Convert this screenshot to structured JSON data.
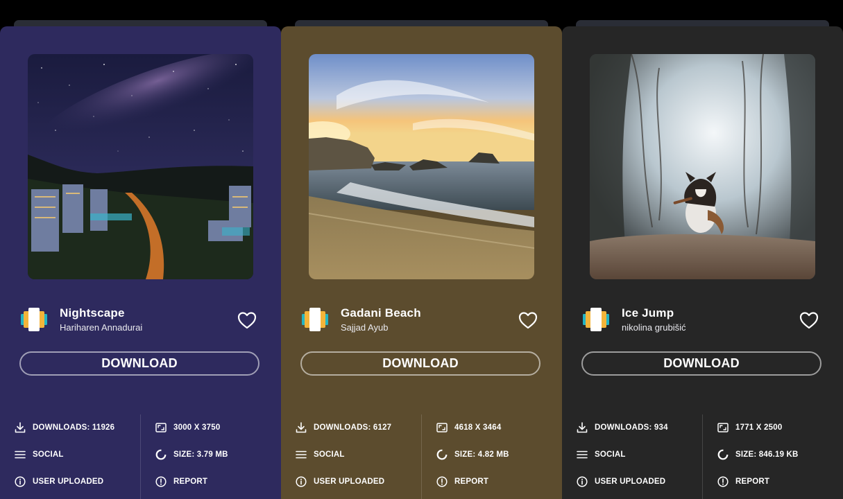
{
  "cards": [
    {
      "title": "Nightscape",
      "author": "Hariharen Annadurai",
      "download_label": "DOWNLOAD",
      "downloads": "DOWNLOADS: 11926",
      "resolution": "3000 X 3750",
      "category": "SOCIAL",
      "size": "SIZE: 3.79 MB",
      "source": "USER UPLOADED",
      "report": "REPORT",
      "bg_color": "#2e2a5e",
      "tab_color": "#2a2d36"
    },
    {
      "title": "Gadani Beach",
      "author": "Sajjad Ayub",
      "download_label": "DOWNLOAD",
      "downloads": "DOWNLOADS: 6127",
      "resolution": "4618 X 3464",
      "category": "SOCIAL",
      "size": "SIZE: 4.82 MB",
      "source": "USER UPLOADED",
      "report": "REPORT",
      "bg_color": "#5c4c2e",
      "tab_color": "#2a2d36"
    },
    {
      "title": "Ice Jump",
      "author": "nikolina grubišić",
      "download_label": "DOWNLOAD",
      "downloads": "DOWNLOADS: 934",
      "resolution": "1771 X 2500",
      "category": "SOCIAL",
      "size": "SIZE: 846.19 KB",
      "source": "USER UPLOADED",
      "report": "REPORT",
      "bg_color": "#262626",
      "tab_color": "#2a2d36"
    }
  ]
}
